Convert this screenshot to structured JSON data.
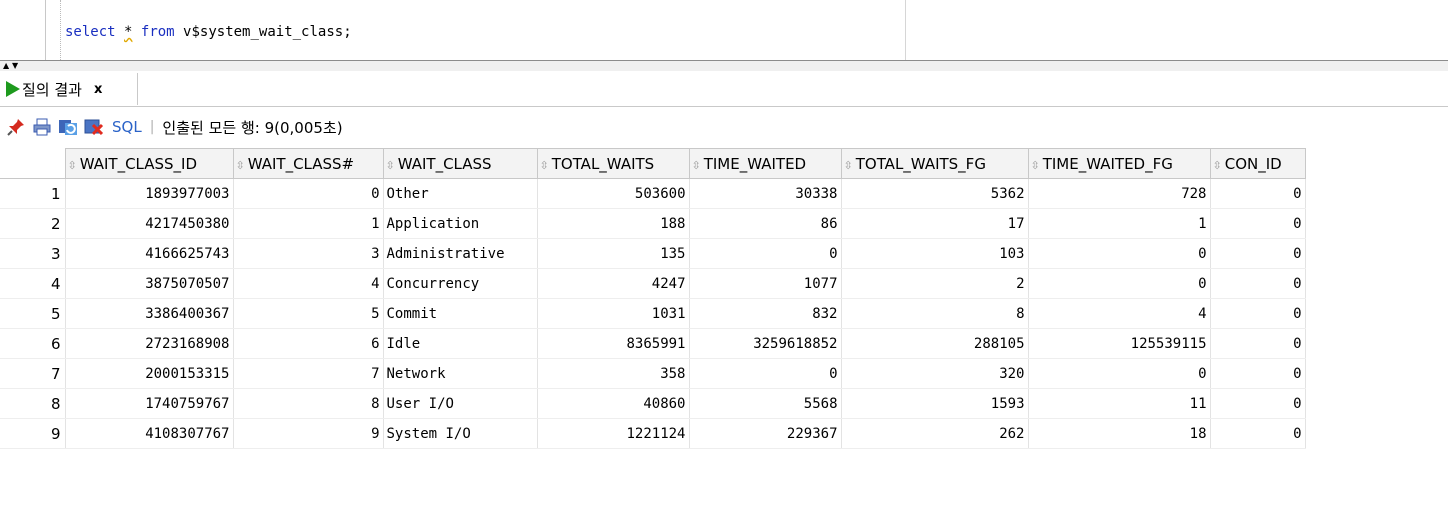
{
  "editor": {
    "query": {
      "kw_select": "select",
      "star": "*",
      "kw_from": "from",
      "table": "v$system_wait_class;"
    }
  },
  "results_tab": {
    "label": "질의 결과",
    "close": "x"
  },
  "toolbar": {
    "icons": [
      "pin-icon",
      "print-icon",
      "refresh-icon",
      "export-icon"
    ],
    "sql_label": "SQL",
    "separator": "|",
    "status": "인출된 모든 행: 9(0,005초)"
  },
  "grid": {
    "columns": [
      "WAIT_CLASS_ID",
      "WAIT_CLASS#",
      "WAIT_CLASS",
      "TOTAL_WAITS",
      "TIME_WAITED",
      "TOTAL_WAITS_FG",
      "TIME_WAITED_FG",
      "CON_ID"
    ],
    "sort_glyph": "⇳",
    "rows": [
      [
        "1",
        "1893977003",
        "0",
        "Other",
        "503600",
        "30338",
        "5362",
        "728",
        "0"
      ],
      [
        "2",
        "4217450380",
        "1",
        "Application",
        "188",
        "86",
        "17",
        "1",
        "0"
      ],
      [
        "3",
        "4166625743",
        "3",
        "Administrative",
        "135",
        "0",
        "103",
        "0",
        "0"
      ],
      [
        "4",
        "3875070507",
        "4",
        "Concurrency",
        "4247",
        "1077",
        "2",
        "0",
        "0"
      ],
      [
        "5",
        "3386400367",
        "5",
        "Commit",
        "1031",
        "832",
        "8",
        "4",
        "0"
      ],
      [
        "6",
        "2723168908",
        "6",
        "Idle",
        "8365991",
        "3259618852",
        "288105",
        "125539115",
        "0"
      ],
      [
        "7",
        "2000153315",
        "7",
        "Network",
        "358",
        "0",
        "320",
        "0",
        "0"
      ],
      [
        "8",
        "1740759767",
        "8",
        "User I/O",
        "40860",
        "5568",
        "1593",
        "11",
        "0"
      ],
      [
        "9",
        "4108307767",
        "9",
        "System I/O",
        "1221124",
        "229367",
        "262",
        "18",
        "0"
      ]
    ]
  },
  "colors": {
    "keyword": "#1a2fc0",
    "run_icon": "#1e9a1e",
    "sql_link": "#2b63c8"
  }
}
